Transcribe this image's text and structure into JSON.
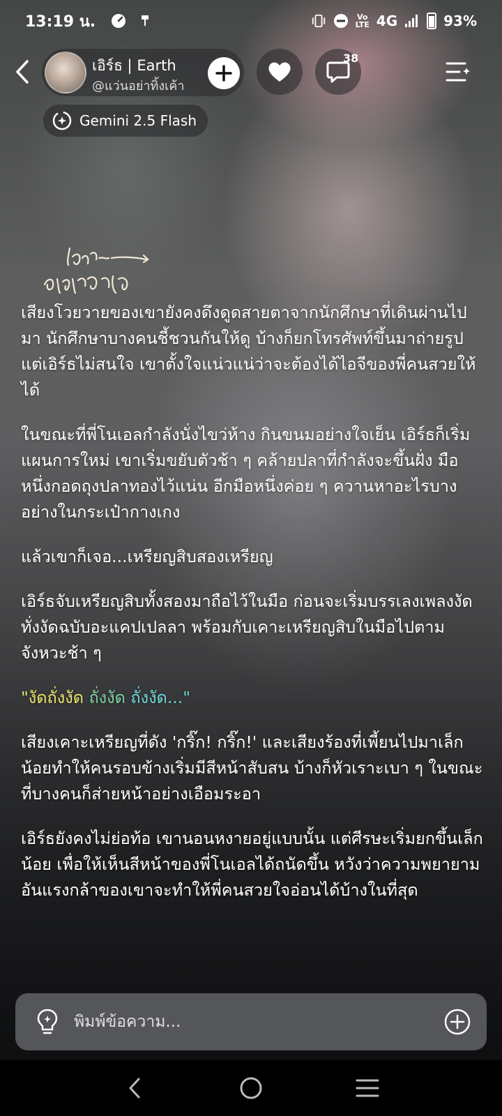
{
  "status_bar": {
    "time": "13:19 น.",
    "network": "4G",
    "battery": "93%"
  },
  "header": {
    "character_name": "เอิร์ธ | Earth",
    "handle": "@แว่นอย่าทิ้งเค้า",
    "comment_count": "38"
  },
  "model": {
    "label": "Gemini 2.5 Flash"
  },
  "story": {
    "paragraphs": [
      "เสียงโวยวายของเขายังคงดึงดูดสายตาจากนักศึกษาที่เดินผ่านไปมา นักศึกษาบางคนชี้ชวนกันให้ดู บ้างก็ยกโทรศัพท์ขึ้นมาถ่ายรูป แต่เอิร์ธไม่สนใจ เขาตั้งใจแน่วแน่ว่าจะต้องได้ไอจีของพี่คนสวยให้ได้",
      "ในขณะที่พี่โนเอลกำลังนั่งไขว่ห้าง กินขนมอย่างใจเย็น เอิร์ธก็เริ่มแผนการใหม่ เขาเริ่มขยับตัวช้า ๆ คล้ายปลาที่กำลังจะขึ้นฝั่ง มือหนึ่งกอดถุงปลาทองไว้แน่น อีกมือหนึ่งค่อย ๆ ควานหาอะไรบางอย่างในกระเป๋ากางเกง",
      "แล้วเขาก็เจอ...เหรียญสิบสองเหรียญ",
      "เอิร์ธจับเหรียญสิบทั้งสองมาถือไว้ในมือ ก่อนจะเริ่มบรรเลงเพลงงัดทั่งงัดฉบับอะแคปเปลลา พร้อมกับเคาะเหรียญสิบในมือไปตามจังหวะช้า ๆ"
    ],
    "dialogue": {
      "part1": "\"งัดถั่งงัด",
      "part2": " ถั่งงัด",
      "part3": " ถั่งงัด...\""
    },
    "paragraphs_after": [
      "เสียงเคาะเหรียญที่ดัง 'กริ๊ก! กริ๊ก!' และเสียงร้องที่เพี้ยนไปมาเล็กน้อยทำให้คนรอบข้างเริ่มมีสีหน้าสับสน บ้างก็หัวเราะเบา ๆ ในขณะที่บางคนก็ส่ายหน้าอย่างเอือมระอา",
      "เอิร์ธยังคงไม่ย่อท้อ เขานอนหงายอยู่แบบนั้น แต่ศีรษะเริ่มยกขึ้นเล็กน้อย เพื่อให้เห็นสีหน้าของพี่โนเอลได้ถนัดขึ้น หวังว่าความพยายามอันแรงกล้าของเขาจะทำให้พี่คนสวยใจอ่อนได้บ้างในที่สุด"
    ]
  },
  "input": {
    "placeholder": "พิมพ์ข้อความ..."
  },
  "watermark": {
    "text": "แว่น อย่าทิ้งเค้า"
  }
}
